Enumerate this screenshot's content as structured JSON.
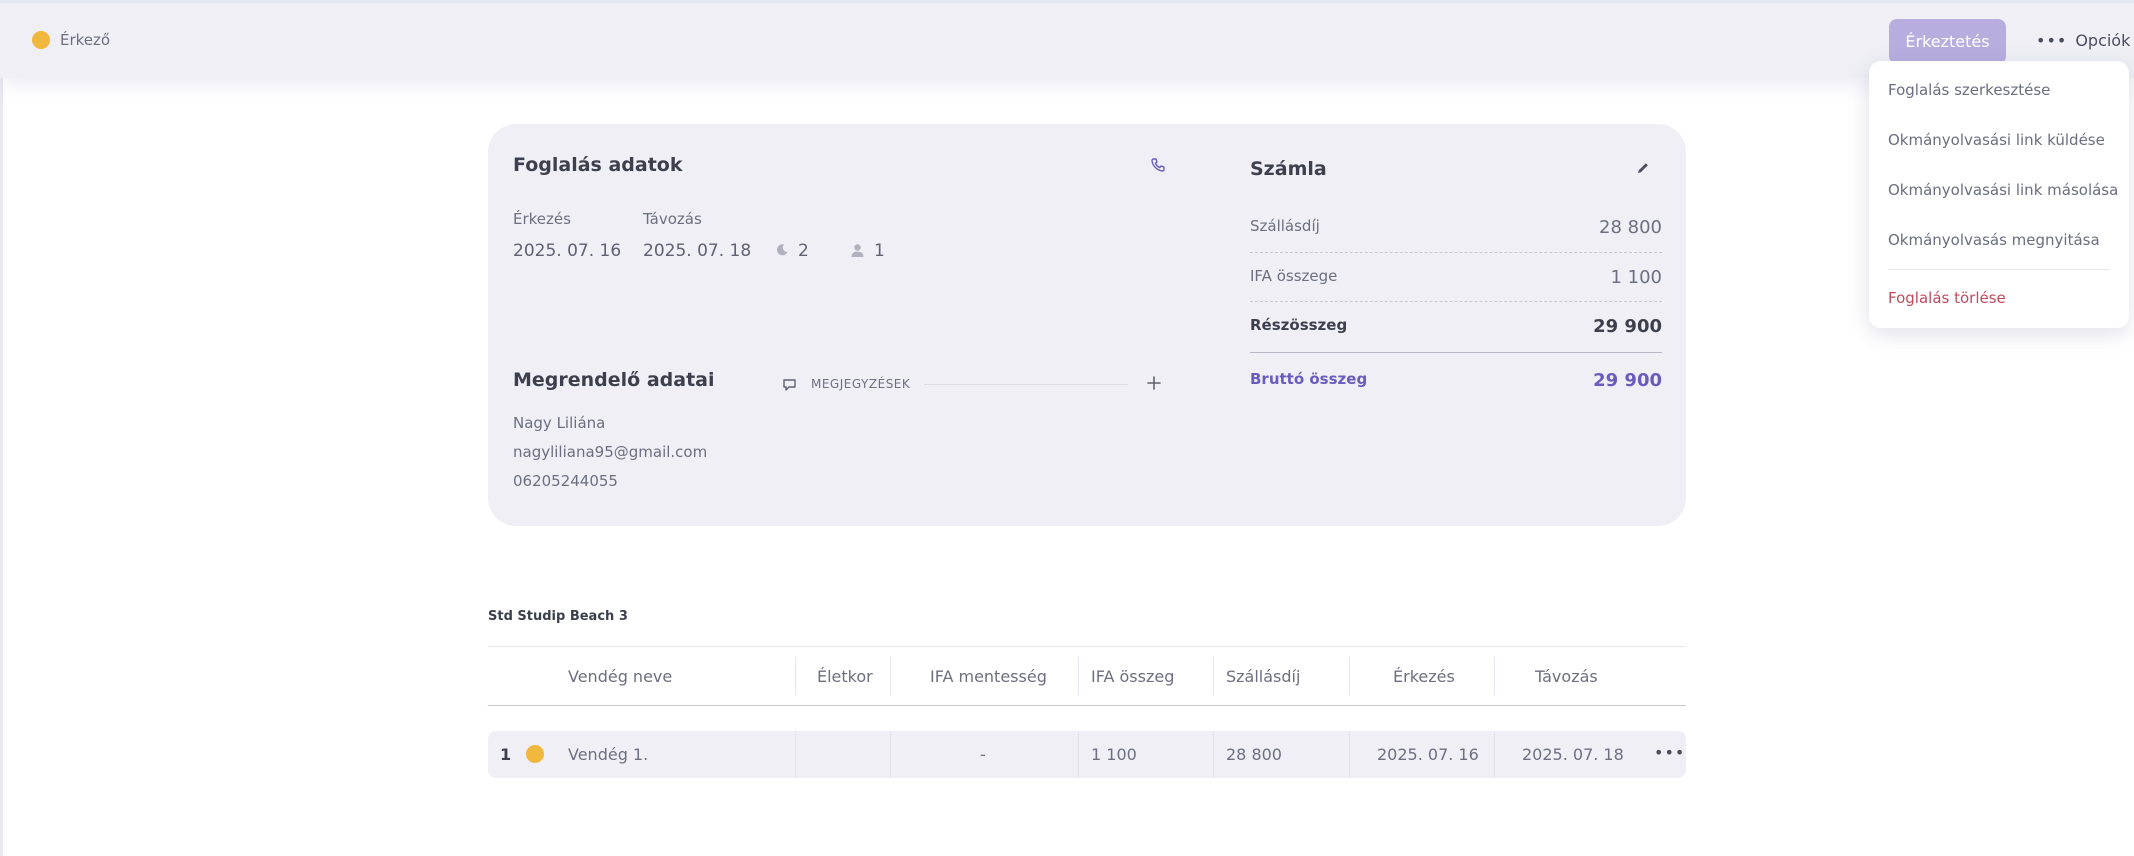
{
  "header": {
    "status_label": "Érkező",
    "status_color": "#f1b73f",
    "checkin_button": "Érkeztetés",
    "options_label": "Opciók"
  },
  "options_menu": {
    "items": [
      {
        "label": "Foglalás szerkesztése"
      },
      {
        "label": "Okmányolvasási link küldése"
      },
      {
        "label": "Okmányolvasási link másolása"
      },
      {
        "label": "Okmányolvasás megnyitása"
      },
      {
        "label": "Foglalás törlése",
        "danger": true
      }
    ]
  },
  "booking": {
    "title": "Foglalás adatok",
    "arrival_label": "Érkezés",
    "arrival_value": "2025. 07. 16",
    "departure_label": "Távozás",
    "departure_value": "2025. 07. 18",
    "nights": "2",
    "guests": "1"
  },
  "customer": {
    "title": "Megrendelő adatai",
    "name": "Nagy Liliána",
    "email": "nagyliliana95@gmail.com",
    "phone": "06205244055",
    "notes_label": "MEGJEGYZÉSEK"
  },
  "invoice": {
    "title": "Számla",
    "rows": [
      {
        "label": "Szállásdíj",
        "value": "28 800"
      },
      {
        "label": "IFA összege",
        "value": "1 100"
      },
      {
        "label": "Részösszeg",
        "value": "29 900"
      }
    ],
    "gross_label": "Bruttó összeg",
    "gross_value": "29 900",
    "accent_color": "#6a5bbf"
  },
  "room": {
    "name": "Std Studip Beach 3",
    "columns": [
      "Vendég neve",
      "Életkor",
      "IFA mentesség",
      "IFA összeg",
      "Szállásdíj",
      "Érkezés",
      "Távozás"
    ],
    "guests": [
      {
        "index": "1",
        "name": "Vendég 1.",
        "age": "",
        "ifa_exempt": "-",
        "ifa_amount": "1 100",
        "fee": "28 800",
        "arrival": "2025. 07. 16",
        "departure": "2025. 07. 18"
      }
    ]
  }
}
